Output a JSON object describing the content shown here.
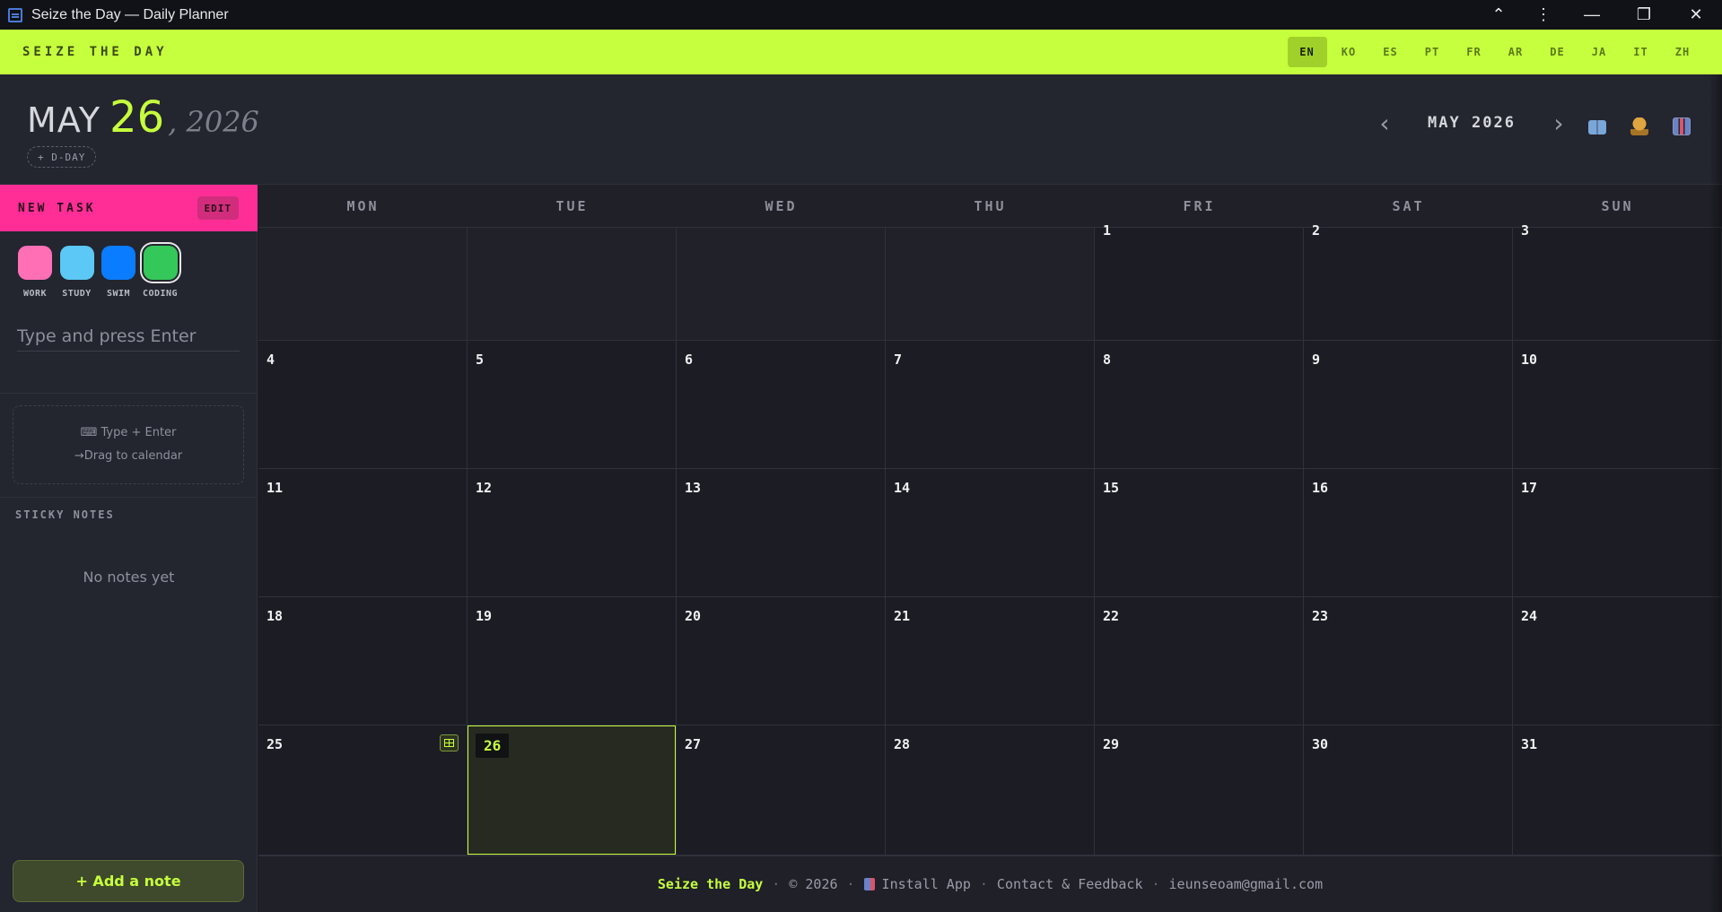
{
  "window": {
    "title": "Seize the Day — Daily Planner"
  },
  "titlebar_controls": [
    {
      "name": "collapse-chevron-icon",
      "glyph": "⌃"
    },
    {
      "name": "more-menu-icon",
      "glyph": "⋮"
    },
    {
      "name": "minimize-icon",
      "glyph": "—"
    },
    {
      "name": "restore-icon",
      "glyph": "❐"
    },
    {
      "name": "close-icon",
      "glyph": "✕"
    }
  ],
  "topbar": {
    "brand": "SEIZE THE DAY",
    "languages": [
      "EN",
      "KO",
      "ES",
      "PT",
      "FR",
      "AR",
      "DE",
      "JA",
      "IT",
      "ZH"
    ],
    "active_language": "EN"
  },
  "header": {
    "month": "MAY",
    "day": "26",
    "year": ", 2026",
    "dday_label": "+ D-DAY",
    "prev": "‹",
    "next": "›",
    "month_label": "MAY 2026",
    "icons": [
      "book-icon",
      "trophy-icon",
      "chart-icon"
    ]
  },
  "sidebar": {
    "new_task_label": "NEW TASK",
    "edit_label": "EDIT",
    "categories": [
      {
        "name": "WORK",
        "color": "#ff6fb5"
      },
      {
        "name": "STUDY",
        "color": "#5bc8f5"
      },
      {
        "name": "SWIM",
        "color": "#0a7cff"
      },
      {
        "name": "CODING",
        "color": "#34c759"
      }
    ],
    "selected_category": "CODING",
    "task_placeholder": "Type and press Enter",
    "hint_line1": "⌨ Type + Enter",
    "hint_line2": "→Drag to calendar",
    "sticky_title": "STICKY NOTES",
    "no_notes": "No notes yet",
    "add_note": "+ Add a note"
  },
  "calendar": {
    "weekdays": [
      "MON",
      "TUE",
      "WED",
      "THU",
      "FRI",
      "SAT",
      "SUN"
    ],
    "leading_blank_days": 4,
    "days_in_month": 31,
    "today": 26
  },
  "footer": {
    "brand": "Seize the Day",
    "copyright": "© 2026",
    "install": "Install App",
    "contact": "Contact & Feedback",
    "email": "ieunseoam@gmail.com",
    "separator": "·"
  },
  "colors": {
    "accent": "#c6ff3d",
    "new_task": "#ff2e97",
    "background": "#1c1d24"
  }
}
